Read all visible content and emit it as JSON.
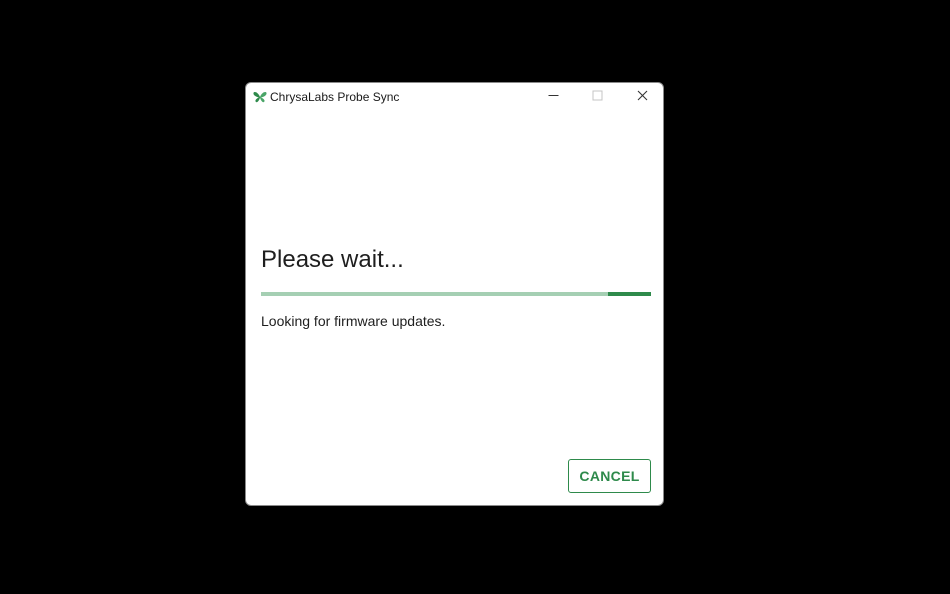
{
  "window": {
    "title": "ChrysaLabs Probe Sync",
    "app_icon": "butterfly-icon",
    "controls": {
      "minimize_icon": "minimize-icon",
      "maximize_icon": "maximize-icon",
      "close_icon": "close-icon"
    }
  },
  "main": {
    "heading": "Please wait...",
    "status_text": "Looking for firmware updates.",
    "progress_fraction": 0.11
  },
  "footer": {
    "cancel_label": "CANCEL"
  },
  "colors": {
    "accent": "#2e8a4b",
    "accent_light": "#a5cfb3",
    "backdrop": "#000000"
  }
}
